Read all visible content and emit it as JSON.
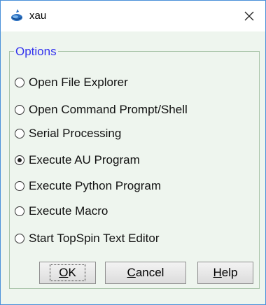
{
  "window": {
    "title": "xau",
    "icon": "topspin-app-icon",
    "close_icon": "close-icon"
  },
  "options": {
    "title": "Options",
    "items": [
      {
        "label": "Open File Explorer",
        "checked": false
      },
      {
        "label": "Open Command Prompt/Shell",
        "checked": false
      },
      {
        "label": "Serial Processing",
        "checked": false
      },
      {
        "label": "Execute AU Program",
        "checked": true
      },
      {
        "label": "Execute Python Program",
        "checked": false
      },
      {
        "label": "Execute Macro",
        "checked": false
      },
      {
        "label": "Start TopSpin Text Editor",
        "checked": false
      }
    ]
  },
  "buttons": {
    "ok": {
      "mnemonic": "O",
      "rest": "K"
    },
    "cancel": {
      "mnemonic": "C",
      "rest": "ancel"
    },
    "help": {
      "mnemonic": "H",
      "rest": "elp"
    }
  },
  "colors": {
    "options_title": "#3333ee",
    "dialog_background": "#eef5ee",
    "window_border": "#4a90d9"
  }
}
